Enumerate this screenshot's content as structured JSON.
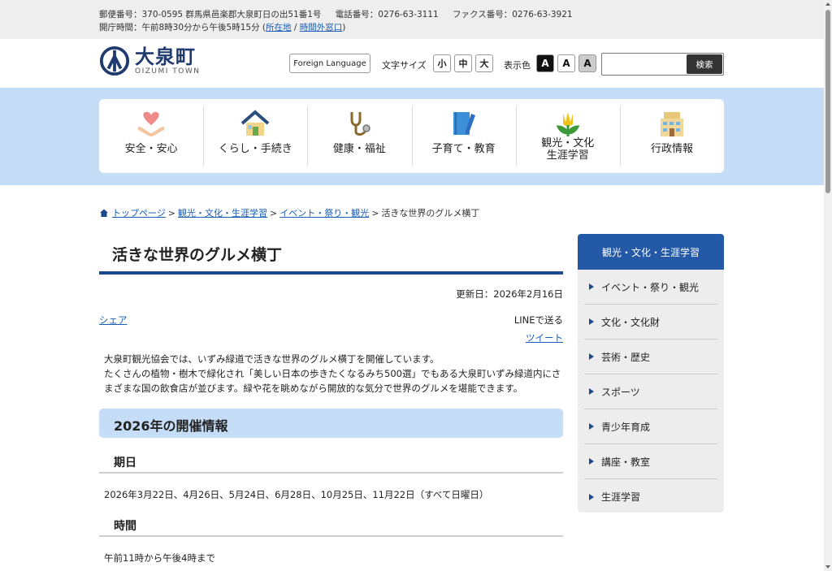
{
  "topbar": {
    "postal": "郵便番号：370-0595 群馬県邑楽郡大泉町日の出51番1号",
    "phone": "電話番号：0276-63-3111",
    "fax": "ファクス番号：0276-63-3921",
    "hours_prefix": "開庁時間：午前8時30分から午後5時15分 (",
    "location_link": "所在地",
    "slash": " / ",
    "afterhours_link": "時間外窓口",
    "hours_suffix": ")"
  },
  "header": {
    "logo_name": "大泉町",
    "logo_roman": "OIZUMI TOWN",
    "foreign_language": "Foreign Language",
    "font_size_label": "文字サイズ",
    "font_sizes": [
      "小",
      "中",
      "大"
    ],
    "color_label": "表示色",
    "color_options": [
      "A",
      "A",
      "A"
    ],
    "search_placeholder": "",
    "search_button": "検索"
  },
  "nav": [
    {
      "label": "安全・安心",
      "icon": "heart-hands-icon"
    },
    {
      "label": "くらし・手続き",
      "icon": "house-icon"
    },
    {
      "label": "健康・福祉",
      "icon": "stethoscope-icon"
    },
    {
      "label": "子育て・教育",
      "icon": "notebook-pencil-icon"
    },
    {
      "label": "観光・文化\n生涯学習",
      "icon": "tulip-icon"
    },
    {
      "label": "行政情報",
      "icon": "building-icon"
    }
  ],
  "breadcrumb": {
    "home": "トップページ",
    "crumb1": "観光・文化・生涯学習",
    "crumb2": "イベント・祭り・観光",
    "current": "活きな世界のグルメ横丁",
    "sep": ">"
  },
  "article": {
    "title": "活きな世界のグルメ横丁",
    "updated": "更新日：2026年2月16日",
    "share": "シェア",
    "line": "LINEで送る",
    "tweet": "ツイート",
    "paragraph1": "大泉町観光協会では、いずみ緑道で活きな世界のグルメ横丁を開催しています。",
    "paragraph2": "たくさんの植物・樹木で緑化され「美しい日本の歩きたくなるみち500選」でもある大泉町いずみ緑道内にさまざまな国の飲食店が並びます。緑や花を眺めながら開放的な気分で世界のグルメを堪能できます。",
    "section_heading": "2026年の開催情報",
    "dates_heading": "期日",
    "dates_text": "2026年3月22日、4月26日、5月24日、6月28日、10月25日、11月22日（すべて日曜日）",
    "time_heading": "時間",
    "time_text": "午前11時から午後4時まで"
  },
  "sidebar": {
    "heading": "観光・文化・生涯学習",
    "items": [
      "イベント・祭り・観光",
      "文化・文化財",
      "芸術・歴史",
      "スポーツ",
      "青少年育成",
      "講座・教室",
      "生涯学習"
    ]
  },
  "colors": {
    "accent": "#2359a6",
    "band": "#c5ddf7",
    "link": "#1a5db4"
  }
}
